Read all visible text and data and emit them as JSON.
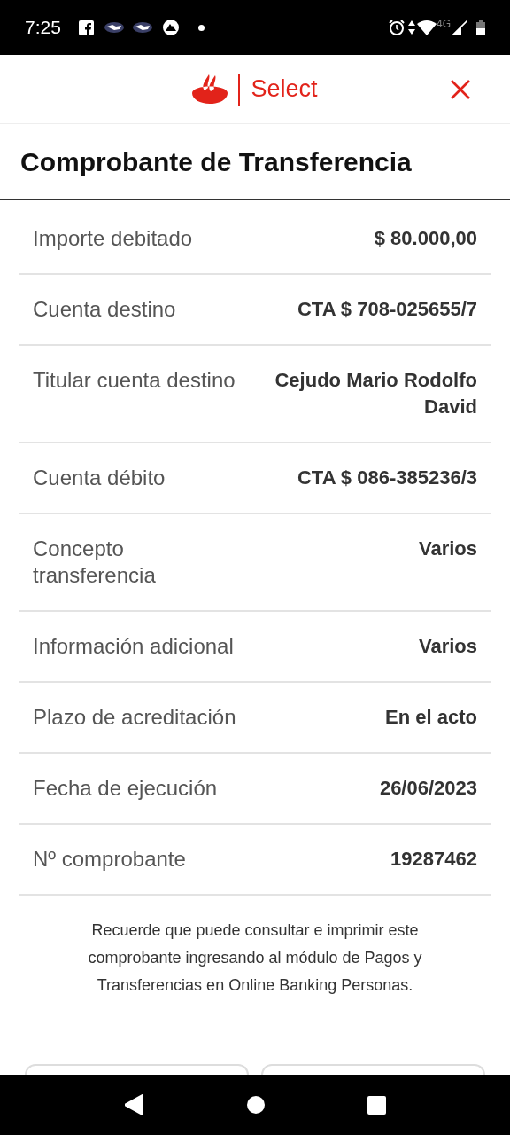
{
  "status_bar": {
    "time": "7:25",
    "network": "4G"
  },
  "header": {
    "brand": "Select"
  },
  "title": "Comprobante de Transferencia",
  "rows": [
    {
      "label": "Importe debitado",
      "value": "$ 80.000,00"
    },
    {
      "label": "Cuenta destino",
      "value": "CTA $ 708-025655/7"
    },
    {
      "label": "Titular cuenta destino",
      "value": "Cejudo Mario Rodolfo David"
    },
    {
      "label": "Cuenta débito",
      "value": "CTA $ 086-385236/3"
    },
    {
      "label": "Concepto transferencia",
      "value": "Varios"
    },
    {
      "label": "Información adicional",
      "value": "Varios"
    },
    {
      "label": "Plazo de acreditación",
      "value": "En el acto"
    },
    {
      "label": "Fecha de ejecución",
      "value": "26/06/2023"
    },
    {
      "label": "Nº comprobante",
      "value": "19287462"
    }
  ],
  "note": "Recuerde que puede consultar e imprimir este comprobante ingresando al módulo de Pagos y Transferencias en Online Banking Personas."
}
